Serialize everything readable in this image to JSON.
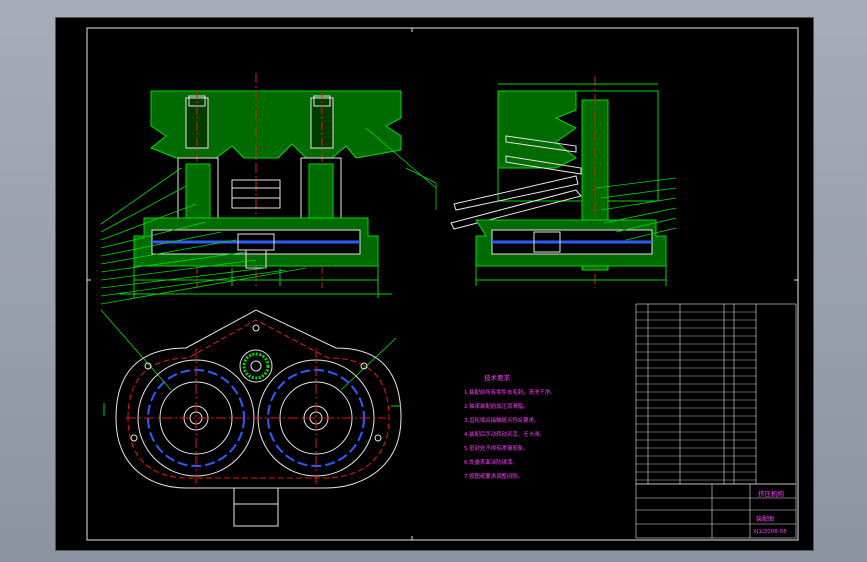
{
  "drawing": {
    "background": "#000000",
    "colors": {
      "green": "#00d800",
      "white": "#e6e6e6",
      "red": "#e01818",
      "blue": "#2f5cff",
      "magenta": "#ff3bff",
      "cyan": "#30d0d0",
      "yellow": "#e6e600"
    },
    "tech_notes": {
      "title": "技术要求",
      "items": [
        "1.装配前所有零件去毛刺，清洗干净。",
        "2.轴承装配前加注润滑脂。",
        "3.齿轮啮合接触斑点符合要求。",
        "4.装配后手动转动灵活，无卡滞。",
        "5.密封处不得有渗漏现象。",
        "6.外露表面涂防锈漆。",
        "7.按图纸要求调整间隙。"
      ]
    },
    "title_block": {
      "name": "挤压机构",
      "drawing_no": "XJ1/2008-05",
      "code": "装配图"
    }
  }
}
